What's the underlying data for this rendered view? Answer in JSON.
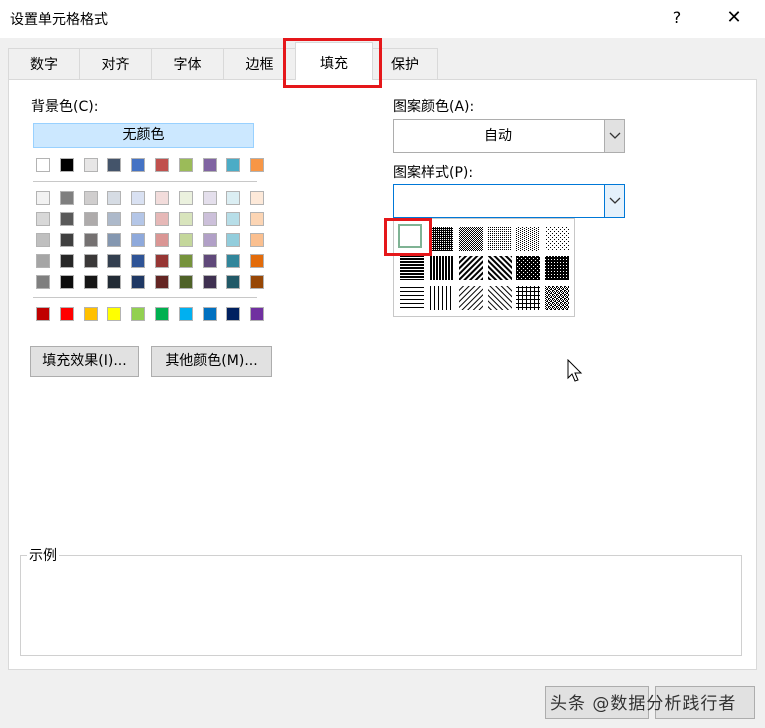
{
  "window": {
    "title": "设置单元格格式",
    "help_label": "?",
    "close_label": "✕"
  },
  "tabs": [
    {
      "label": "数字",
      "active": false
    },
    {
      "label": "对齐",
      "active": false
    },
    {
      "label": "字体",
      "active": false
    },
    {
      "label": "边框",
      "active": false
    },
    {
      "label": "填充",
      "active": true
    },
    {
      "label": "保护",
      "active": false
    }
  ],
  "fill": {
    "background_label": "背景色(C):",
    "no_color_label": "无颜色",
    "theme_top_row": [
      "#ffffff",
      "#000000",
      "#e7e6e6",
      "#44546a",
      "#4472c4",
      "#c0504d",
      "#9bbb59",
      "#8064a2",
      "#4bacc6",
      "#f79646"
    ],
    "theme_shades": [
      [
        "#f2f2f2",
        "#7f7f7f",
        "#d0cece",
        "#d6dce4",
        "#d9e1f2",
        "#f2dcdb",
        "#ebf1de",
        "#e4dfec",
        "#dbeef3",
        "#fde9d9"
      ],
      [
        "#d8d8d8",
        "#595959",
        "#aeabab",
        "#adb9ca",
        "#b4c6e7",
        "#e6b8b7",
        "#d8e4bc",
        "#ccc0da",
        "#b7dee8",
        "#fcd5b4"
      ],
      [
        "#bfbfbf",
        "#3f3f3f",
        "#757171",
        "#8497b0",
        "#8ea9db",
        "#da9694",
        "#c4d79b",
        "#b1a0c7",
        "#92cddc",
        "#fabf8f"
      ],
      [
        "#a5a5a5",
        "#262626",
        "#3a3838",
        "#333f4f",
        "#2f5496",
        "#963634",
        "#76933c",
        "#60497a",
        "#31869b",
        "#e26b0a"
      ],
      [
        "#7f7f7f",
        "#0c0c0c",
        "#161616",
        "#222b35",
        "#1f3864",
        "#632523",
        "#4f6228",
        "#3f3151",
        "#215967",
        "#974706"
      ]
    ],
    "standard_colors": [
      "#c00000",
      "#ff0000",
      "#ffc000",
      "#ffff00",
      "#92d050",
      "#00b050",
      "#00b0f0",
      "#0070c0",
      "#002060",
      "#7030a0"
    ],
    "fill_effects_label": "填充效果(I)...",
    "more_colors_label": "其他颜色(M)...",
    "pattern_color_label": "图案颜色(A):",
    "pattern_color_value": "自动",
    "pattern_style_label": "图案样式(P):",
    "pattern_style_value": ""
  },
  "example": {
    "label": "示例"
  },
  "buttons": {
    "ok_label": "",
    "cancel_label": ""
  },
  "watermark": "头条 @数据分析践行者",
  "highlight_color": "#e5171a"
}
